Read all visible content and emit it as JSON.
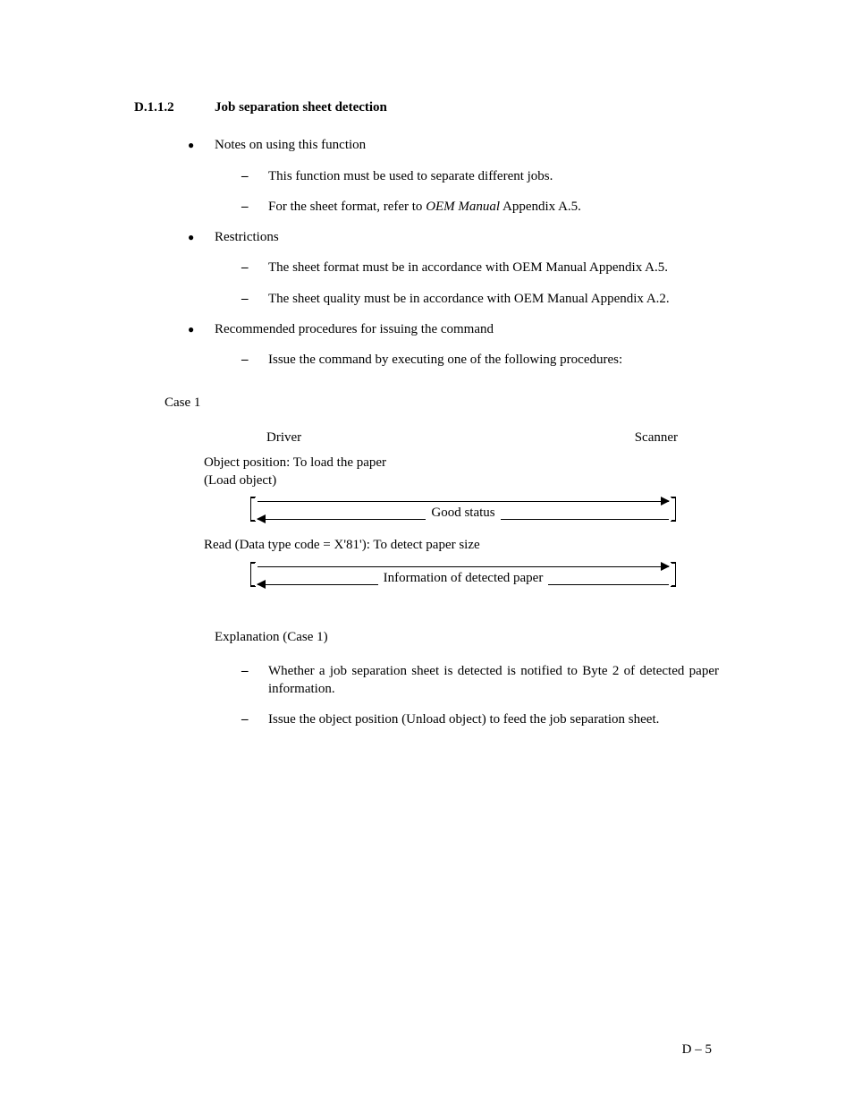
{
  "section": {
    "number": "D.1.1.2",
    "title": "Job separation sheet detection"
  },
  "bullets": [
    {
      "label": "Notes on using this function",
      "items": [
        {
          "text": "This function must be used to separate different jobs."
        },
        {
          "prefix": "For the sheet format, refer to ",
          "italic": "OEM Manual",
          "suffix": " Appendix A.5."
        }
      ]
    },
    {
      "label": "Restrictions",
      "items": [
        {
          "text": "The sheet format must be in accordance with OEM Manual Appendix A.5."
        },
        {
          "text": "The sheet quality must be in accordance with OEM Manual Appendix A.2."
        }
      ]
    },
    {
      "label": "Recommended procedures for issuing the command",
      "items": [
        {
          "text": "Issue the command by executing one of the following procedures:"
        }
      ]
    }
  ],
  "case": {
    "label": "Case 1",
    "driver": "Driver",
    "scanner": "Scanner",
    "msg1_line1": "Object position:  To load the paper",
    "msg1_line2": "(Load object)",
    "resp1": "Good status",
    "msg2": "Read (Data type code  =  X'81'):  To detect paper size",
    "resp2": "Information of detected paper"
  },
  "explanation": {
    "heading": "Explanation (Case 1)",
    "items": [
      "Whether a job separation sheet is detected is notified to Byte 2 of detected paper information.",
      "Issue the object position (Unload object) to feed the job separation sheet."
    ]
  },
  "footer": "D – 5"
}
